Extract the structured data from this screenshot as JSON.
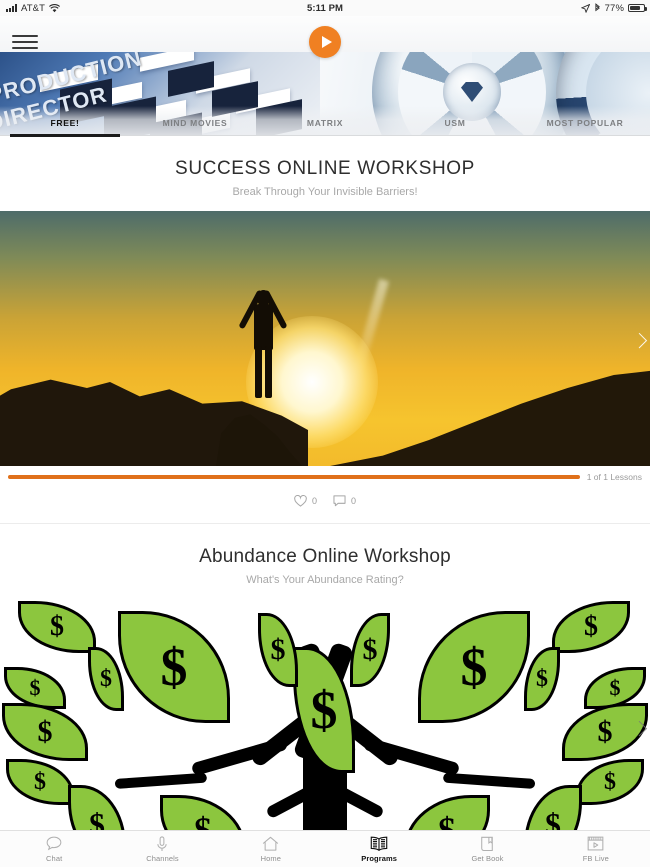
{
  "status_bar": {
    "carrier": "AT&T",
    "time": "5:11 PM",
    "battery_percent": "77%",
    "signal_icon": "signal-bars-icon",
    "wifi_icon": "wifi-icon",
    "location_icon": "location-arrow-icon",
    "bluetooth_icon": "bluetooth-icon",
    "battery_icon": "battery-icon"
  },
  "header": {
    "menu_icon": "hamburger-menu-icon",
    "play_icon": "play-button-icon",
    "banner_text_line1": "PRODUCTION",
    "banner_text_line2": "DIRECTOR"
  },
  "tabs": [
    {
      "label": "FREE!",
      "active": true
    },
    {
      "label": "MIND MOVIES",
      "active": false
    },
    {
      "label": "MATRIX",
      "active": false
    },
    {
      "label": "USM",
      "active": false
    },
    {
      "label": "MOST POPULAR",
      "active": false
    }
  ],
  "programs": [
    {
      "title": "SUCCESS ONLINE WORKSHOP",
      "subtitle": "Break Through Your Invisible Barriers!",
      "image_alt": "sunset-silhouette-arms-raised",
      "progress_percent": 100,
      "lessons_text": "1 of 1 Lessons",
      "likes": "0",
      "comments": "0",
      "like_icon": "heart-icon",
      "comment_icon": "comment-bubble-icon",
      "next_icon": "chevron-right-icon"
    },
    {
      "title": "Abundance Online Workshop",
      "subtitle": "What's Your Abundance Rating?",
      "image_alt": "money-tree-dollar-leaves",
      "next_icon": "chevron-right-icon"
    }
  ],
  "bottom_nav": [
    {
      "label": "Chat",
      "icon": "chat-bubble-icon",
      "active": false
    },
    {
      "label": "Channels",
      "icon": "microphone-icon",
      "active": false
    },
    {
      "label": "Home",
      "icon": "home-icon",
      "active": false
    },
    {
      "label": "Programs",
      "icon": "open-book-icon",
      "active": true
    },
    {
      "label": "Get Book",
      "icon": "book-icon",
      "active": false
    },
    {
      "label": "FB Live",
      "icon": "video-player-icon",
      "active": false
    }
  ],
  "colors": {
    "accent_orange": "#f08022",
    "progress_orange": "#e0701a",
    "leaf_green": "#8cc63e"
  }
}
